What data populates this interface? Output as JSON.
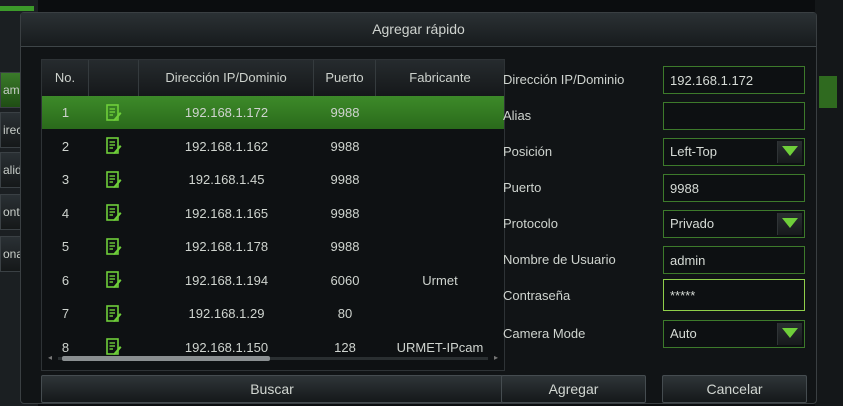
{
  "background": {
    "left_items": [
      "ama",
      "irec",
      "alid",
      "onti",
      "ona"
    ]
  },
  "dialog": {
    "title": "Agregar rápido"
  },
  "table": {
    "headers": [
      "No.",
      "",
      "Dirección IP/Dominio",
      "Puerto",
      "Fabricante"
    ],
    "selected_index": 0,
    "rows": [
      {
        "no": "1",
        "ip": "192.168.1.172",
        "port": "9988",
        "manufacturer": ""
      },
      {
        "no": "2",
        "ip": "192.168.1.162",
        "port": "9988",
        "manufacturer": ""
      },
      {
        "no": "3",
        "ip": "192.168.1.45",
        "port": "9988",
        "manufacturer": ""
      },
      {
        "no": "4",
        "ip": "192.168.1.165",
        "port": "9988",
        "manufacturer": ""
      },
      {
        "no": "5",
        "ip": "192.168.1.178",
        "port": "9988",
        "manufacturer": ""
      },
      {
        "no": "6",
        "ip": "192.168.1.194",
        "port": "6060",
        "manufacturer": "Urmet"
      },
      {
        "no": "7",
        "ip": "192.168.1.29",
        "port": "80",
        "manufacturer": ""
      },
      {
        "no": "8",
        "ip": "192.168.1.150",
        "port": "128",
        "manufacturer": "URMET-IPcam"
      }
    ],
    "row_icon": "edit-icon"
  },
  "form": {
    "ip_label": "Dirección IP/Dominio",
    "ip_value": "192.168.1.172",
    "alias_label": "Alias",
    "alias_value": "",
    "position_label": "Posición",
    "position_value": "Left-Top",
    "port_label": "Puerto",
    "port_value": "9988",
    "protocol_label": "Protocolo",
    "protocol_value": "Privado",
    "user_label": "Nombre de Usuario",
    "user_value": "admin",
    "password_label": "Contraseña",
    "password_value": "*****",
    "camera_mode_label": "Camera Mode",
    "camera_mode_value": "Auto"
  },
  "buttons": {
    "search": "Buscar",
    "add": "Agregar",
    "cancel": "Cancelar"
  },
  "colors": {
    "accent_green": "#3d8a29",
    "icon_green": "#6fcf3a"
  }
}
